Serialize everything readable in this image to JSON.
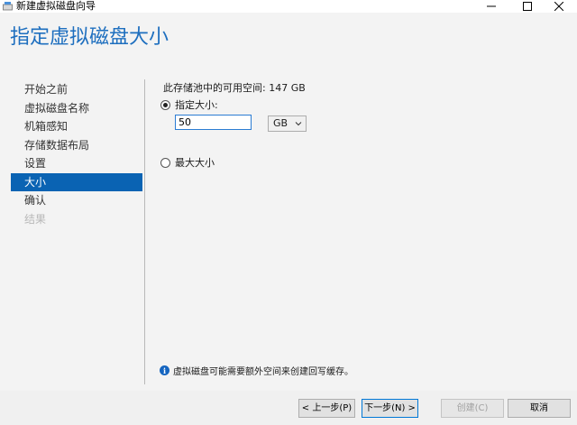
{
  "window": {
    "title": "新建虚拟磁盘向导"
  },
  "page_title": "指定虚拟磁盘大小",
  "nav": {
    "items": [
      {
        "label": "开始之前",
        "state": "normal"
      },
      {
        "label": "虚拟磁盘名称",
        "state": "normal"
      },
      {
        "label": "机箱感知",
        "state": "normal"
      },
      {
        "label": "存储数据布局",
        "state": "normal"
      },
      {
        "label": "设置",
        "state": "normal"
      },
      {
        "label": "大小",
        "state": "active"
      },
      {
        "label": "确认",
        "state": "normal"
      },
      {
        "label": "结果",
        "state": "disabled"
      }
    ]
  },
  "content": {
    "available_space": "此存储池中的可用空间: 147 GB",
    "specify_size_label": "指定大小:",
    "size_value": "50",
    "unit": "GB",
    "max_size_label": "最大大小",
    "selected_option": "specify",
    "note": "虚拟磁盘可能需要额外空间来创建回写缓存。"
  },
  "footer": {
    "previous_label": "< 上一步(P)",
    "next_label": "下一步(N) >",
    "create_label": "创建(C)",
    "cancel_label": "取消"
  },
  "colors": {
    "accent": "#0a63b3",
    "title": "#1e6fbf",
    "info_icon": "#1565c0"
  }
}
